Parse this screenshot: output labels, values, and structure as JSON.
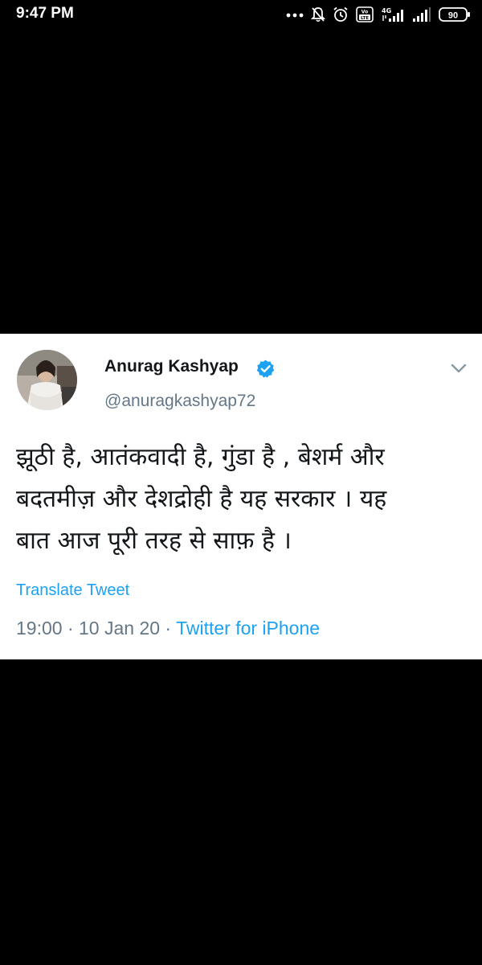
{
  "status_bar": {
    "time": "9:47 PM",
    "battery": "90",
    "network": "4G"
  },
  "tweet": {
    "author_name": "Anurag Kashyap",
    "author_handle": "@anuragkashyap72",
    "verified": true,
    "text_lines": [
      "झूठी है, आतंकवादी है, गुंडा है , बेशर्म और",
      "बदतमीज़ और देशद्रोही है यह सरकार । यह",
      "बात आज पूरी तरह से साफ़ है ।"
    ],
    "translate_label": "Translate Tweet",
    "time": "19:00",
    "separator": " · ",
    "date": "10 Jan 20",
    "source": "Twitter for iPhone"
  },
  "colors": {
    "background": "#000000",
    "card": "#ffffff",
    "accent": "#1da1f2",
    "secondary_text": "#657786",
    "primary_text": "#14171a"
  }
}
